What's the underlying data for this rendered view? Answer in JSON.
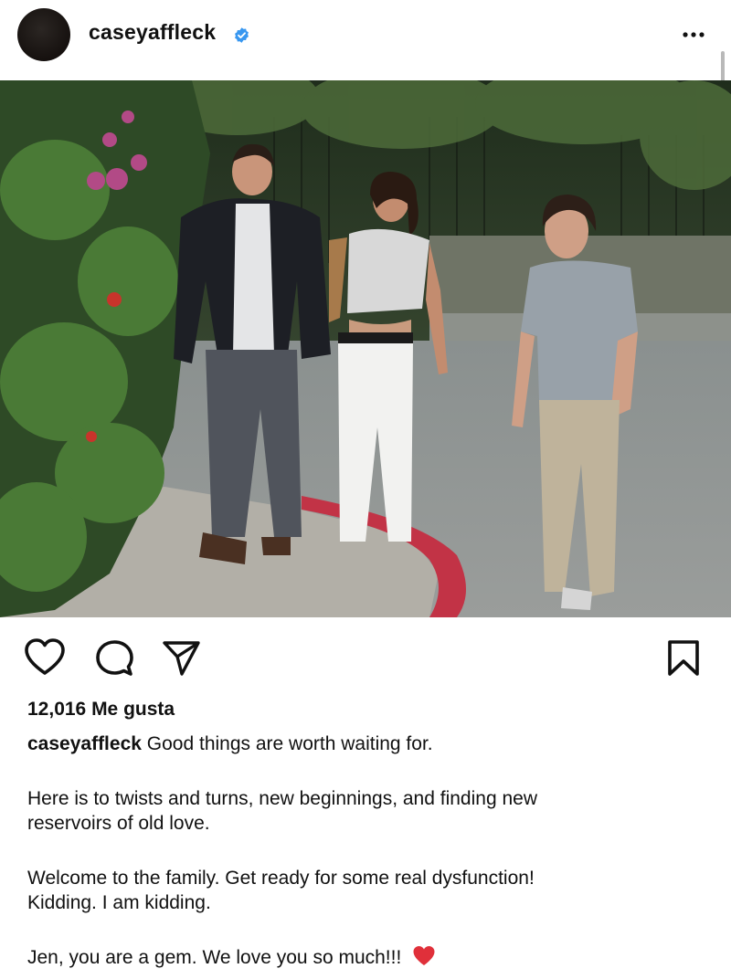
{
  "header": {
    "username": "caseyaffleck",
    "verified": true,
    "more_icon": "more-options-icon"
  },
  "post": {
    "image_alt": "Photo of three people walking on a sidewalk beside a hedge"
  },
  "actions": {
    "like_icon": "heart-outline-icon",
    "comment_icon": "comment-bubble-icon",
    "share_icon": "paper-plane-icon",
    "save_icon": "bookmark-outline-icon"
  },
  "likes": {
    "text": "12,016 Me gusta"
  },
  "caption": {
    "username": "caseyaffleck",
    "line1": "Good things are worth waiting for.",
    "line2": "Here is to twists and turns, new beginnings, and finding new",
    "line3": "reservoirs of old love.",
    "line4": "Welcome to the family. Get ready for some real dysfunction!",
    "line5": "Kidding. I am kidding.",
    "line6": "Jen, you are a gem.  We love you so much!!!",
    "emoji": "red-heart-emoji"
  },
  "colors": {
    "verified_blue": "#3897f0",
    "text": "#111111",
    "emoji_red": "#e0303a"
  }
}
